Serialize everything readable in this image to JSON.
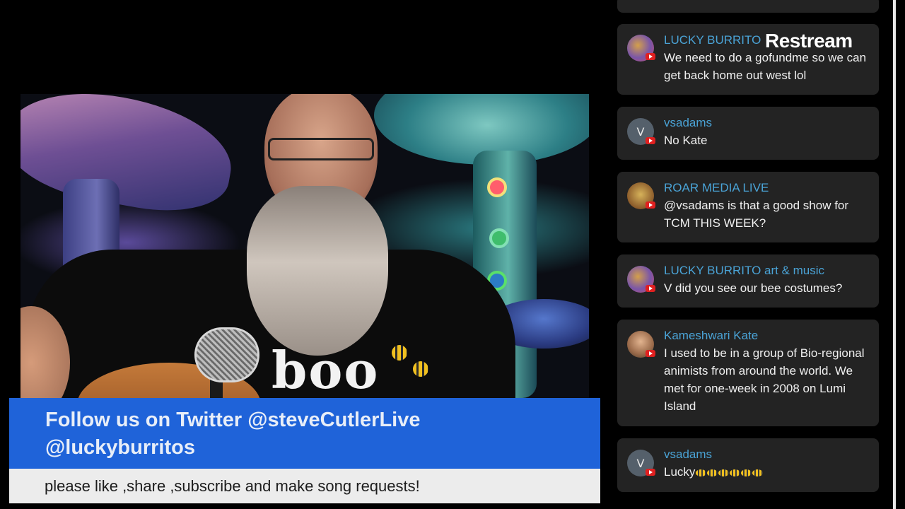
{
  "stream": {
    "shirt_text": "boo"
  },
  "banner": {
    "twitter_line1": "Follow us on Twitter @steveCutlerLive",
    "twitter_line2": "@luckyburritos",
    "request_line": "please like ,share ,subscribe  and make song requests!"
  },
  "branding": {
    "logo_text": "Restream"
  },
  "chat": {
    "messages": [
      {
        "author": "LUCKY BURRITO",
        "text": "We need to do a gofundme so we can get back home out west lol",
        "avatar": "avatar-photo",
        "platform": "youtube-icon"
      },
      {
        "author": "vsadams",
        "text": "No Kate",
        "avatar_letter": "V",
        "platform": "youtube-icon"
      },
      {
        "author": "ROAR MEDIA LIVE",
        "text": "@vsadams is that a good show for TCM THIS WEEK?",
        "avatar": "avatar-photo",
        "platform": "youtube-icon"
      },
      {
        "author": "LUCKY BURRITO art & music",
        "text": "V did you see our bee costumes?",
        "avatar": "avatar-photo",
        "platform": "youtube-icon"
      },
      {
        "author": "Kameshwari Kate",
        "text": "I used to be in a group of Bio-regional animists from around the world. We met for one-week in 2008 on Lumi Island",
        "avatar": "avatar-photo",
        "platform": "youtube-icon"
      },
      {
        "author": "vsadams",
        "text": "Lucky",
        "emoji": "bee-icon",
        "emoji_count": 6,
        "avatar_letter": "V",
        "platform": "youtube-icon"
      }
    ]
  },
  "colors": {
    "author_name": "#4aa3d6",
    "chat_card": "#232323",
    "banner_blue": "#1f63d9",
    "banner_gray": "#ececec"
  }
}
